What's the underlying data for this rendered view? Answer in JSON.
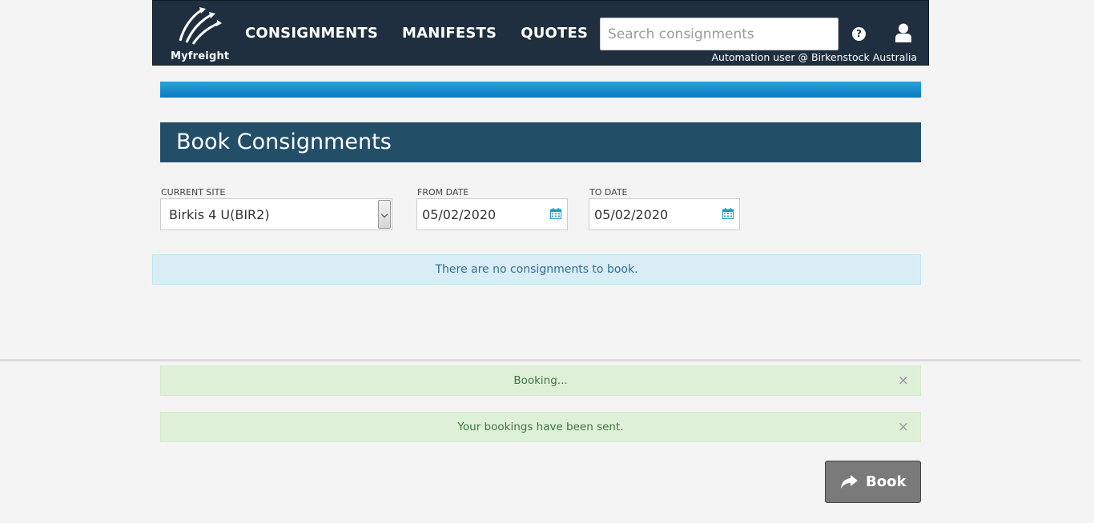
{
  "app": {
    "brand": "Myfreight",
    "nav_items": [
      "CONSIGNMENTS",
      "MANIFESTS",
      "QUOTES"
    ],
    "search_placeholder": "Search consignments",
    "help_icon": "question-circle-icon",
    "user_icon": "user-icon",
    "user_label": "Automation user @ Birkenstock Australia"
  },
  "page": {
    "title": "Book Consignments",
    "progress_color": "#0a7bbf",
    "header_color": "#234e68"
  },
  "filters": {
    "site_label": "CURRENT SITE",
    "site_value": "Birkis 4 U(BIR2)",
    "from_label": "FROM DATE",
    "from_value": "05/02/2020",
    "to_label": "TO DATE",
    "to_value": "05/02/2020"
  },
  "messages": {
    "no_consignments": "There are no consignments to book.",
    "booking": "Booking...",
    "sent": "Your bookings have been sent.",
    "close_glyph": "×"
  },
  "actions": {
    "book_label": "Book"
  }
}
